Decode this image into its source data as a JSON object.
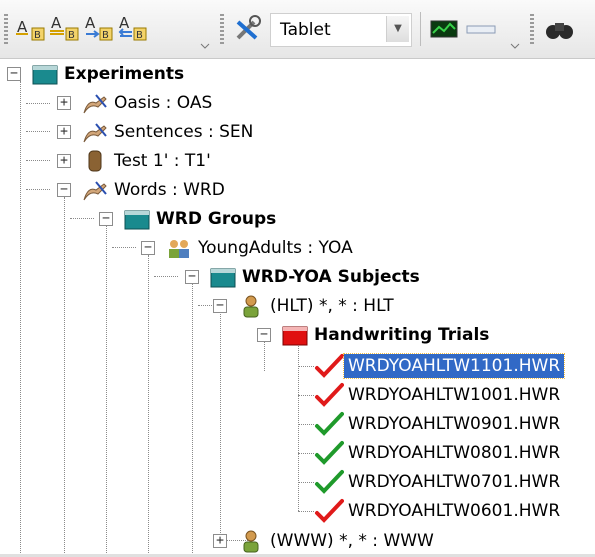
{
  "toolbar": {
    "buttons": [
      {
        "name": "format-text-a-icon"
      },
      {
        "name": "format-text-b-icon"
      },
      {
        "name": "format-text-c-icon"
      },
      {
        "name": "format-text-d-icon"
      },
      {
        "name": "tools-icon"
      },
      {
        "name": "chart-monitor-icon"
      },
      {
        "name": "slider-icon"
      },
      {
        "name": "binoculars-icon"
      }
    ],
    "device_select_value": "Tablet"
  },
  "tree": [
    {
      "label": "Experiments",
      "icon": "teal-folder-icon",
      "bold": true,
      "expander": "minus"
    },
    {
      "label": "Oasis : OAS",
      "icon": "pen-hand-icon",
      "bold": false,
      "expander": "plus"
    },
    {
      "label": "Sentences : SEN",
      "icon": "pen-hand-icon",
      "bold": false,
      "expander": "plus"
    },
    {
      "label": "Test 1' : T1'",
      "icon": "hand-icon",
      "bold": false,
      "expander": "plus"
    },
    {
      "label": "Words : WRD",
      "icon": "pen-hand-icon",
      "bold": false,
      "expander": "minus"
    },
    {
      "label": "WRD Groups",
      "icon": "teal-folder-icon",
      "bold": true,
      "expander": "minus"
    },
    {
      "label": "YoungAdults : YOA",
      "icon": "group-icon",
      "bold": false,
      "expander": "minus"
    },
    {
      "label": "WRD-YOA Subjects",
      "icon": "teal-folder-icon",
      "bold": true,
      "expander": "minus"
    },
    {
      "label": "(HLT) *, * : HLT",
      "icon": "person-icon",
      "bold": false,
      "expander": "minus"
    },
    {
      "label": "Handwriting Trials",
      "icon": "red-folder-icon",
      "bold": true,
      "expander": "minus"
    },
    {
      "label": "WRDYOAHLTW1101.HWR",
      "icon": "red-check-icon",
      "bold": false,
      "selected": true
    },
    {
      "label": "WRDYOAHLTW1001.HWR",
      "icon": "red-check-icon",
      "bold": false
    },
    {
      "label": "WRDYOAHLTW0901.HWR",
      "icon": "green-check-icon",
      "bold": false
    },
    {
      "label": "WRDYOAHLTW0801.HWR",
      "icon": "green-check-icon",
      "bold": false
    },
    {
      "label": "WRDYOAHLTW0701.HWR",
      "icon": "green-check-icon",
      "bold": false
    },
    {
      "label": "WRDYOAHLTW0601.HWR",
      "icon": "red-check-icon",
      "bold": false
    },
    {
      "label": "(WWW) *, * : WWW",
      "icon": "person-icon",
      "bold": false,
      "expander": "plus"
    }
  ]
}
